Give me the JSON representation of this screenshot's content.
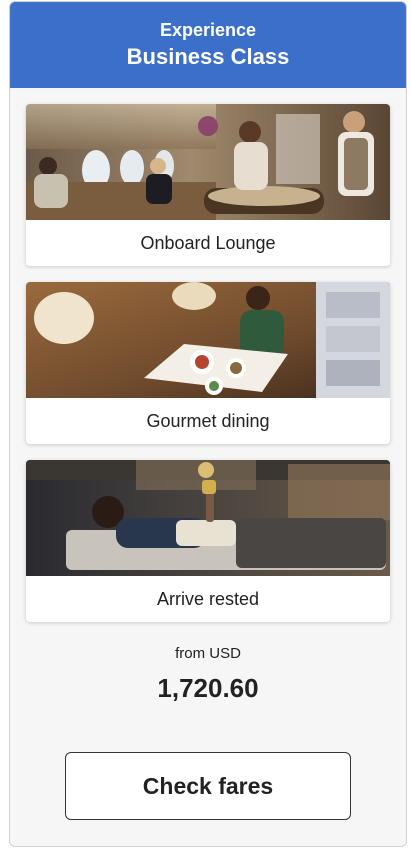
{
  "header": {
    "line1": "Experience",
    "line2": "Business Class"
  },
  "cards": [
    {
      "caption": "Onboard Lounge",
      "image": "onboard-lounge-photo"
    },
    {
      "caption": "Gourmet dining",
      "image": "gourmet-dining-photo"
    },
    {
      "caption": "Arrive rested",
      "image": "flat-bed-rest-photo"
    }
  ],
  "price": {
    "from_label": "from USD",
    "amount": "1,720.60"
  },
  "cta": {
    "label": "Check fares"
  },
  "colors": {
    "header_bg": "#3c6fc9",
    "header_text": "#ffffff",
    "panel_bg": "#f6f6f6"
  }
}
